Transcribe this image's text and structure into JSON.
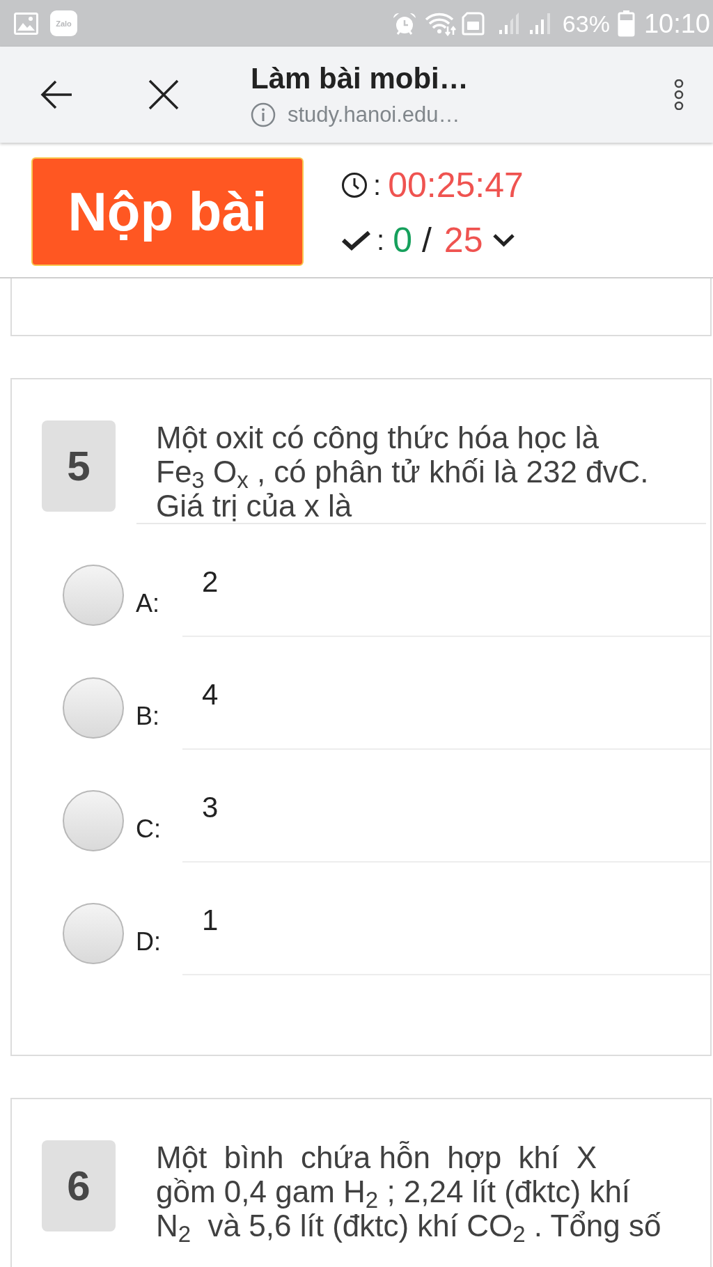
{
  "status_bar": {
    "app_label": "Zalo",
    "battery": "63%",
    "time": "10:10"
  },
  "browser_bar": {
    "title": "Làm bài mobi…",
    "url": "study.hanoi.edu…"
  },
  "exam_header": {
    "submit_button": "Nộp bài",
    "timer": {
      "separator": ":",
      "time": "00:25:47"
    },
    "progress": {
      "separator": ":",
      "answered": "0",
      "divider": "/",
      "total": "25"
    }
  },
  "questions": [
    {
      "number": "5",
      "text": "Một oxit có công thức hóa học là\nFe$_{3}$ O$_{x}$ , có phân tử khối là 232 đvC.\nGiá trị của x là",
      "options": [
        {
          "letter": "A:",
          "answer": "2",
          "selected": false
        },
        {
          "letter": "B:",
          "answer": "4",
          "selected": false
        },
        {
          "letter": "C:",
          "answer": "3",
          "selected": false
        },
        {
          "letter": "D:",
          "answer": "1",
          "selected": false
        }
      ]
    },
    {
      "number": "6",
      "text": "Một  bình  chứa hỗn  hợp  khí  X\ngồm 0,4 gam H$_{2}$ ; 2,24 lít (đktc) khí\nN$_{2}$  và 5,6 lít (đktc) khí CO$_{2}$ . Tổng số"
    }
  ]
}
